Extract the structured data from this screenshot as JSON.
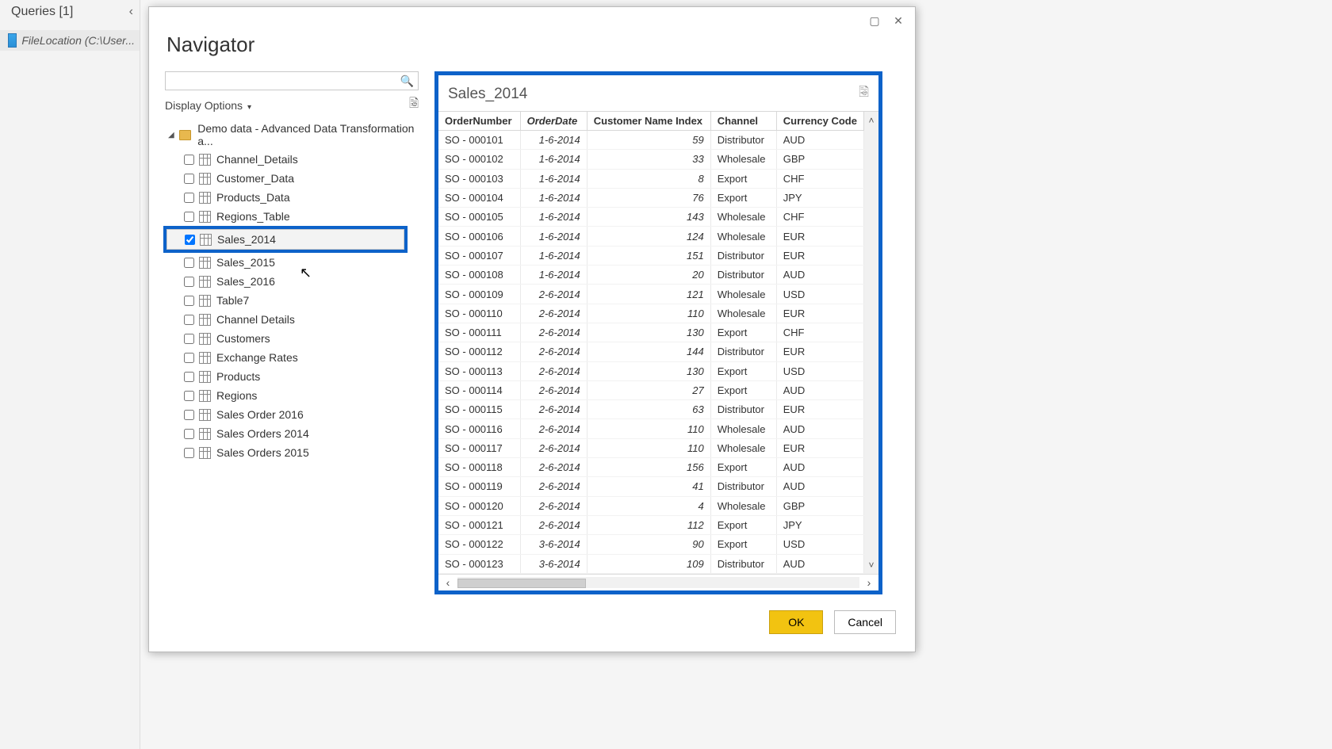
{
  "queries_panel": {
    "title": "Queries [1]",
    "item": "FileLocation (C:\\User..."
  },
  "dialog": {
    "title": "Navigator",
    "display_options": "Display Options",
    "search_placeholder": "",
    "root_label": "Demo data - Advanced Data Transformation a...",
    "tree": [
      {
        "label": "Channel_Details",
        "checked": false,
        "selected": false
      },
      {
        "label": "Customer_Data",
        "checked": false,
        "selected": false
      },
      {
        "label": "Products_Data",
        "checked": false,
        "selected": false
      },
      {
        "label": "Regions_Table",
        "checked": false,
        "selected": false
      },
      {
        "label": "Sales_2014",
        "checked": true,
        "selected": true
      },
      {
        "label": "Sales_2015",
        "checked": false,
        "selected": false
      },
      {
        "label": "Sales_2016",
        "checked": false,
        "selected": false
      },
      {
        "label": "Table7",
        "checked": false,
        "selected": false
      },
      {
        "label": "Channel Details",
        "checked": false,
        "selected": false
      },
      {
        "label": "Customers",
        "checked": false,
        "selected": false
      },
      {
        "label": "Exchange Rates",
        "checked": false,
        "selected": false
      },
      {
        "label": "Products",
        "checked": false,
        "selected": false
      },
      {
        "label": "Regions",
        "checked": false,
        "selected": false
      },
      {
        "label": "Sales Order 2016",
        "checked": false,
        "selected": false
      },
      {
        "label": "Sales Orders 2014",
        "checked": false,
        "selected": false
      },
      {
        "label": "Sales Orders 2015",
        "checked": false,
        "selected": false
      }
    ],
    "preview": {
      "title": "Sales_2014",
      "columns": [
        "OrderNumber",
        "OrderDate",
        "Customer Name Index",
        "Channel",
        "Currency Code"
      ],
      "rows": [
        [
          "SO - 000101",
          "1-6-2014",
          "59",
          "Distributor",
          "AUD"
        ],
        [
          "SO - 000102",
          "1-6-2014",
          "33",
          "Wholesale",
          "GBP"
        ],
        [
          "SO - 000103",
          "1-6-2014",
          "8",
          "Export",
          "CHF"
        ],
        [
          "SO - 000104",
          "1-6-2014",
          "76",
          "Export",
          "JPY"
        ],
        [
          "SO - 000105",
          "1-6-2014",
          "143",
          "Wholesale",
          "CHF"
        ],
        [
          "SO - 000106",
          "1-6-2014",
          "124",
          "Wholesale",
          "EUR"
        ],
        [
          "SO - 000107",
          "1-6-2014",
          "151",
          "Distributor",
          "EUR"
        ],
        [
          "SO - 000108",
          "1-6-2014",
          "20",
          "Distributor",
          "AUD"
        ],
        [
          "SO - 000109",
          "2-6-2014",
          "121",
          "Wholesale",
          "USD"
        ],
        [
          "SO - 000110",
          "2-6-2014",
          "110",
          "Wholesale",
          "EUR"
        ],
        [
          "SO - 000111",
          "2-6-2014",
          "130",
          "Export",
          "CHF"
        ],
        [
          "SO - 000112",
          "2-6-2014",
          "144",
          "Distributor",
          "EUR"
        ],
        [
          "SO - 000113",
          "2-6-2014",
          "130",
          "Export",
          "USD"
        ],
        [
          "SO - 000114",
          "2-6-2014",
          "27",
          "Export",
          "AUD"
        ],
        [
          "SO - 000115",
          "2-6-2014",
          "63",
          "Distributor",
          "EUR"
        ],
        [
          "SO - 000116",
          "2-6-2014",
          "110",
          "Wholesale",
          "AUD"
        ],
        [
          "SO - 000117",
          "2-6-2014",
          "110",
          "Wholesale",
          "EUR"
        ],
        [
          "SO - 000118",
          "2-6-2014",
          "156",
          "Export",
          "AUD"
        ],
        [
          "SO - 000119",
          "2-6-2014",
          "41",
          "Distributor",
          "AUD"
        ],
        [
          "SO - 000120",
          "2-6-2014",
          "4",
          "Wholesale",
          "GBP"
        ],
        [
          "SO - 000121",
          "2-6-2014",
          "112",
          "Export",
          "JPY"
        ],
        [
          "SO - 000122",
          "3-6-2014",
          "90",
          "Export",
          "USD"
        ],
        [
          "SO - 000123",
          "3-6-2014",
          "109",
          "Distributor",
          "AUD"
        ]
      ]
    },
    "footer": {
      "ok": "OK",
      "cancel": "Cancel"
    }
  }
}
